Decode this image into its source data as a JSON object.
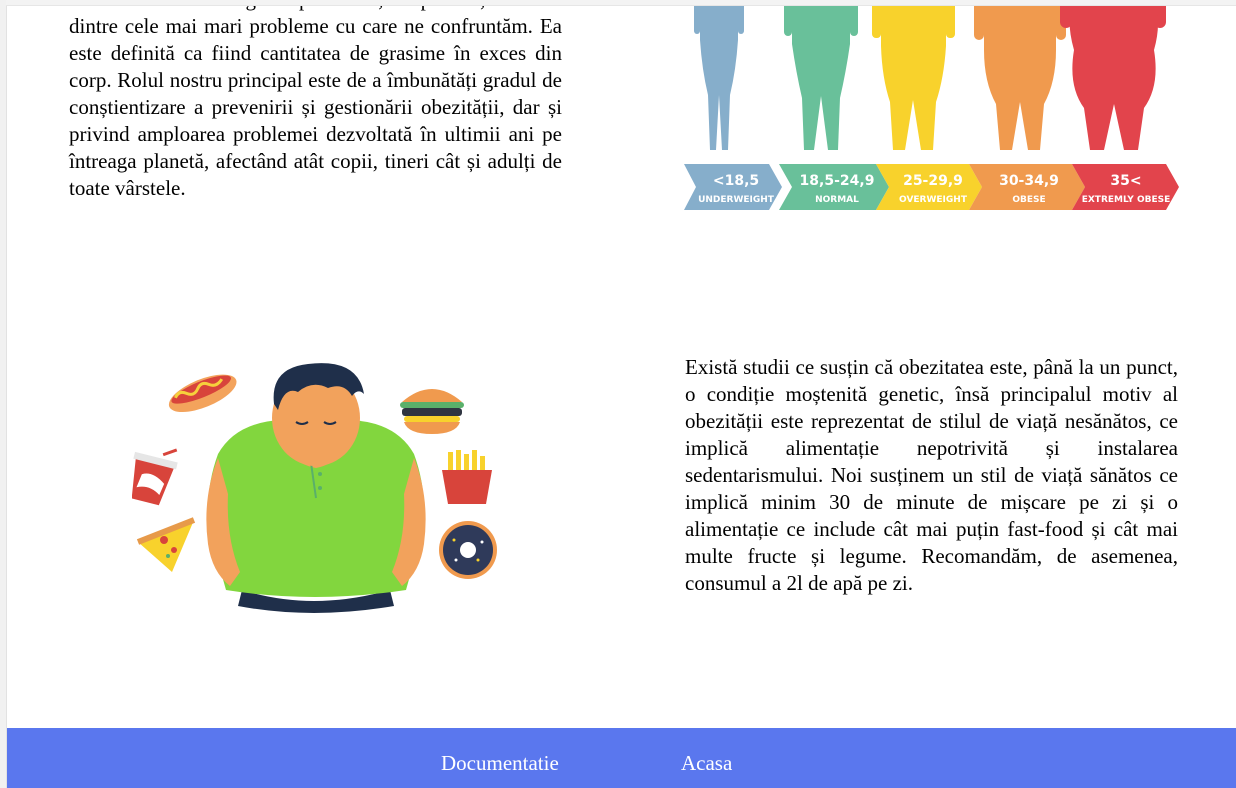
{
  "content": {
    "paragraph_1": "Una dintre cele mai grave probleme, deopotrivă, este una dintre cele mai mari probleme cu care ne confruntăm. Ea este definită ca fiind cantitatea de grasime în exces din corp. Rolul nostru principal este de a îmbunătăți gradul de conștientizare a prevenirii și gestionării obezității, dar și privind amploarea problemei dezvoltată în ultimii ani pe întreaga planetă, afectând atât copii, tineri cât și adulți de toate vârstele.",
    "paragraph_2": "Există studii ce susțin că obezitatea este, până la un punct, o condiție moștenită genetic, însă principalul motiv al obezității este reprezentat de stilul de viață nesănătos, ce implică alimentație nepotrivită și instalarea sedentarismului. Noi susținem un stil de viață sănătos ce implică minim 30 de minute de mișcare pe zi și o alimentație ce include cât mai puțin fast-food și cât mai multe fructe și legume. Recomandăm, de asemenea, consumul a 2l de apă pe zi."
  },
  "bmi_chart": {
    "categories": [
      {
        "range": "<18,5",
        "label": "UNDERWEIGHT",
        "color": "#86aecb"
      },
      {
        "range": "18,5-24,9",
        "label": "NORMAL",
        "color": "#69c09a"
      },
      {
        "range": "25-29,9",
        "label": "OVERWEIGHT",
        "color": "#f8d22c"
      },
      {
        "range": "30-34,9",
        "label": "OBESE",
        "color": "#f09a4e"
      },
      {
        "range": "35<",
        "label": "EXTREMLY OBESE",
        "color": "#e2444c"
      }
    ]
  },
  "footer": {
    "background": "#5a77ee",
    "links": [
      {
        "label": "Documentatie"
      },
      {
        "label": "Acasa"
      }
    ]
  }
}
